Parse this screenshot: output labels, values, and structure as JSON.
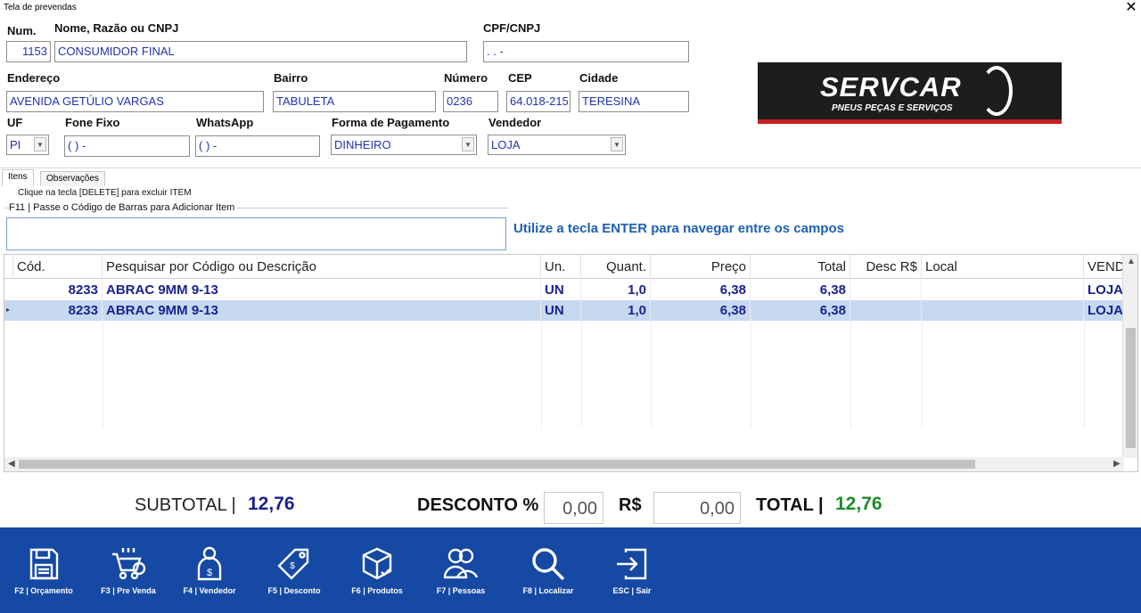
{
  "window": {
    "title": "Tela de prevendas",
    "close": "✕"
  },
  "customer": {
    "num_label": "Num.",
    "num": "1153",
    "name_label": "Nome, Razão ou CNPJ",
    "name": "CONSUMIDOR FINAL",
    "cpf_label": "CPF/CNPJ",
    "cpf": " .  .  -",
    "address_label": "Endereço",
    "address": "AVENIDA GETÚLIO VARGAS",
    "bairro_label": "Bairro",
    "bairro": "TABULETA",
    "numero_label": "Número",
    "numero": "0236",
    "cep_label": "CEP",
    "cep": "64.018-215",
    "cidade_label": "Cidade",
    "cidade": "TERESINA",
    "uf_label": "UF",
    "uf": "PI",
    "fone_label": "Fone Fixo",
    "fone": "(  )     -",
    "whats_label": "WhatsApp",
    "whats": "(  )       -",
    "pagamento_label": "Forma de Pagamento",
    "pagamento": "DINHEIRO",
    "vendedor_label": "Vendedor",
    "vendedor": "LOJA"
  },
  "logo": {
    "main": "SERVCAR",
    "sub": "PNEUS PEÇAS E SERVIÇOS"
  },
  "tabs": [
    {
      "label": "Itens"
    },
    {
      "label": "Observações"
    }
  ],
  "items_panel": {
    "delete_hint": "Clique na tecla [DELETE] para excluir ITEM",
    "barcode_label": "F11 | Passe o Código de Barras para Adicionar Item",
    "enter_hint": "Utilize a tecla ENTER para navegar entre os campos"
  },
  "grid": {
    "headers": [
      "Cód.",
      "Pesquisar por Código ou Descrição",
      "Un.",
      "Quant.",
      "Preço",
      "Total",
      "Desc R$",
      "Local",
      "VEND"
    ],
    "rows": [
      {
        "cod": "8233",
        "desc": "ABRAC 9MM 9-13",
        "un": "UN",
        "quant": "1,0",
        "preco": "6,38",
        "total": "6,38",
        "descr": "",
        "local": "",
        "vend": "LOJA"
      },
      {
        "cod": "8233",
        "desc": "ABRAC 9MM 9-13",
        "un": "UN",
        "quant": "1,0",
        "preco": "6,38",
        "total": "6,38",
        "descr": "",
        "local": "",
        "vend": "LOJA"
      }
    ],
    "selected_row_marker": "▸"
  },
  "totals": {
    "subtotal_label": "SUBTOTAL  |",
    "subtotal": "12,76",
    "desconto_label": "DESCONTO %",
    "desconto_pct": "0,00",
    "rs_label": "R$",
    "desconto_rs": "0,00",
    "total_label": "TOTAL  |",
    "total": "12,76"
  },
  "footer": {
    "buttons": [
      {
        "label": "F2 | Orçamento",
        "icon": "floppy-icon"
      },
      {
        "label": "F3 | Pre Venda",
        "icon": "cart-icon"
      },
      {
        "label": "F4 | Vendedor",
        "icon": "seller-icon"
      },
      {
        "label": "F5 | Desconto",
        "icon": "price-tag-icon"
      },
      {
        "label": "F6 | Produtos",
        "icon": "box-icon"
      },
      {
        "label": "F7 | Pessoas",
        "icon": "people-icon"
      },
      {
        "label": "F8 | Localizar",
        "icon": "search-icon"
      },
      {
        "label": "ESC | Sair",
        "icon": "exit-icon"
      }
    ]
  },
  "colors": {
    "footer_bar": "#1549a3",
    "item_text": "#1a2290",
    "total_green": "#1e8a2a",
    "selected_row": "#c7d9f1",
    "logo_bg": "#1d1d1d",
    "logo_accent": "#c62024"
  }
}
